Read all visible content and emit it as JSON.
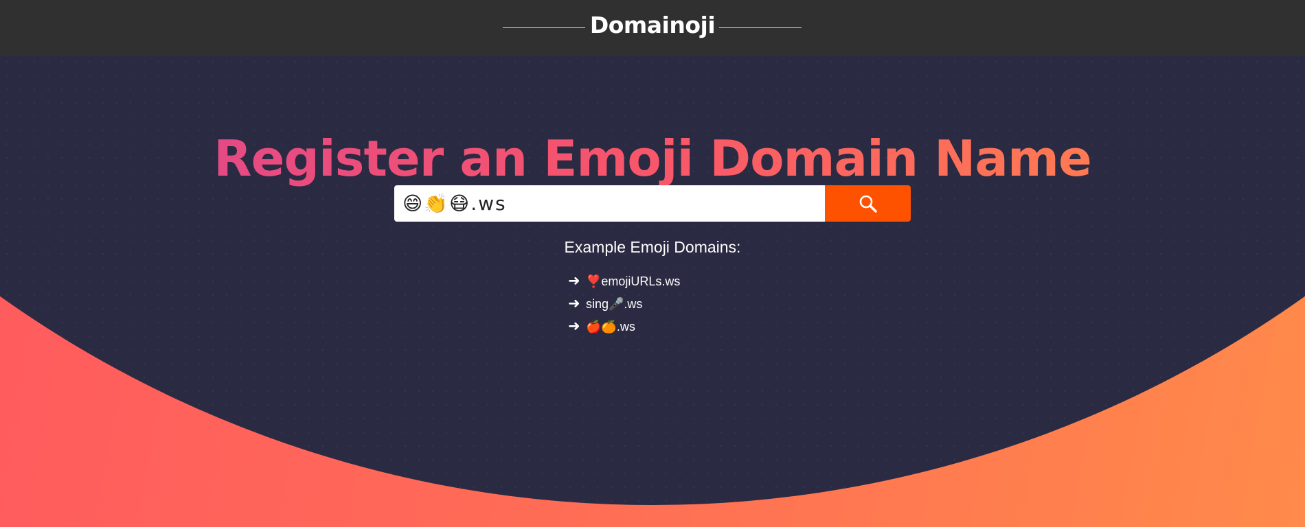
{
  "header": {
    "brand": "Domainoji"
  },
  "hero": {
    "title": "Register an Emoji Domain Name"
  },
  "search": {
    "value": "😄👏😷.ws",
    "button_icon": "search-icon",
    "button_color": "#ff5200"
  },
  "examples": {
    "title": "Example Emoji Domains:",
    "items": [
      {
        "arrow": "➜",
        "label": "❣️emojiURLs.ws"
      },
      {
        "arrow": "➜",
        "label": "sing🎤.ws"
      },
      {
        "arrow": "➜",
        "label": "🍎🍊.ws"
      }
    ]
  },
  "colors": {
    "header_bg": "#303030",
    "hero_bg": "#2a2a42",
    "title_gradient": [
      "#e54a84",
      "#ff7a52"
    ],
    "accent_orange": "#ff5a5f"
  }
}
